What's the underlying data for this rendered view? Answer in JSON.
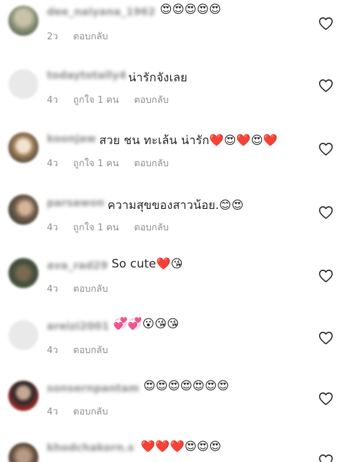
{
  "comments": [
    {
      "username": "dee_naiyana_1962",
      "text": "😍😍😍😍😍",
      "time": "2ว",
      "likes": "",
      "reply": "ตอบกลับ"
    },
    {
      "username": "todaytotally4",
      "text": "น่ารักจังเลย",
      "time": "4ว",
      "likes": "ถูกใจ 1 คน",
      "reply": "ตอบกลับ"
    },
    {
      "username": "koonjaw",
      "text": "สวย ชน ทะเล้น น่ารัก❤️😍❤️😍❤️",
      "time": "4ว",
      "likes": "ถูกใจ 1 คน",
      "reply": "ตอบกลับ"
    },
    {
      "username": "parsawon",
      "text": "ความสุขของสาวน้อย.😊😍",
      "time": "4ว",
      "likes": "ถูกใจ 1 คน",
      "reply": "ตอบกลับ"
    },
    {
      "username": "ava_rad29",
      "text": "So cute❤️😘",
      "time": "4ว",
      "likes": "",
      "reply": "ตอบกลับ"
    },
    {
      "username": "areizi2001",
      "text": "💞💞😮😘😘",
      "time": "4ว",
      "likes": "",
      "reply": "ตอบกลับ"
    },
    {
      "username": "sonsernpantam",
      "text": "😍😍😍😍😍😍😍",
      "time": "4ว",
      "likes": "",
      "reply": "ตอบกลับ"
    },
    {
      "username": "khodchakorn.s",
      "text": "❤️❤️❤️😍😍😍",
      "time": "",
      "likes": "",
      "reply": ""
    }
  ],
  "icons": {
    "like": "heart-outline-icon"
  },
  "colors": {
    "text": "#262626",
    "meta": "#8e8e8e",
    "icon_stroke": "#262626"
  }
}
